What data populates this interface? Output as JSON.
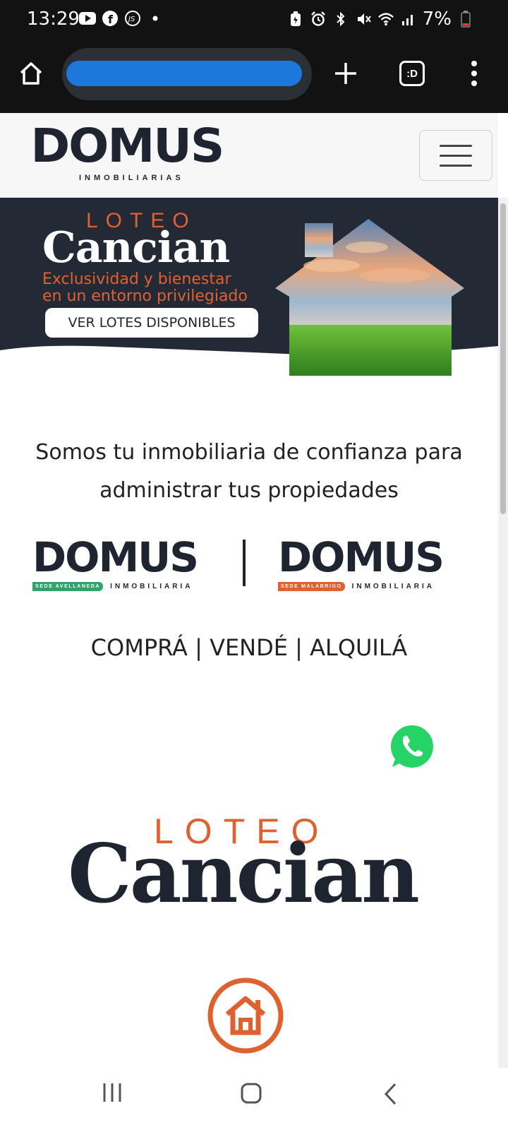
{
  "status_bar": {
    "time": "13:29",
    "battery": "7%",
    "left_icons": [
      "youtube-icon",
      "facebook-icon",
      "js-icon",
      "dot-icon"
    ],
    "right_icons": [
      "battery-saver-icon",
      "alarm-icon",
      "bluetooth-icon",
      "mute-icon",
      "wifi-icon",
      "signal-icon",
      "battery-icon"
    ]
  },
  "browser": {
    "tabs_label": ":D"
  },
  "navbar": {
    "brand": "DOMUS",
    "brand_sub": "INMOBILIARIAS"
  },
  "hero": {
    "loteo": "LOTEO",
    "name": "Cancian",
    "tagline_line1": "Exclusividad y bienestar",
    "tagline_line2": "en un entorno privilegiado",
    "cta": "VER LOTES DISPONIBLES"
  },
  "main": {
    "slogan_line1": "Somos tu inmobiliaria de confianza para",
    "slogan_line2": "administrar tus propiedades",
    "brand_left": {
      "name": "DOMUS",
      "tag": "SEDE AVELLANEDA",
      "sub": "INMOBILIARIA"
    },
    "brand_right": {
      "name": "DOMUS",
      "tag": "SEDE MALABRIGO",
      "sub": "INMOBILIARIA"
    },
    "actions": "COMPRÁ | VENDÉ | ALQUILÁ",
    "loteo_big": "LOTEO",
    "cancian_big": "Cancian"
  },
  "colors": {
    "navy": "#1e2531",
    "orange": "#e06130",
    "green_tag": "#2fa36b",
    "whatsapp": "#25d366",
    "url_redaction": "#1e78db"
  }
}
